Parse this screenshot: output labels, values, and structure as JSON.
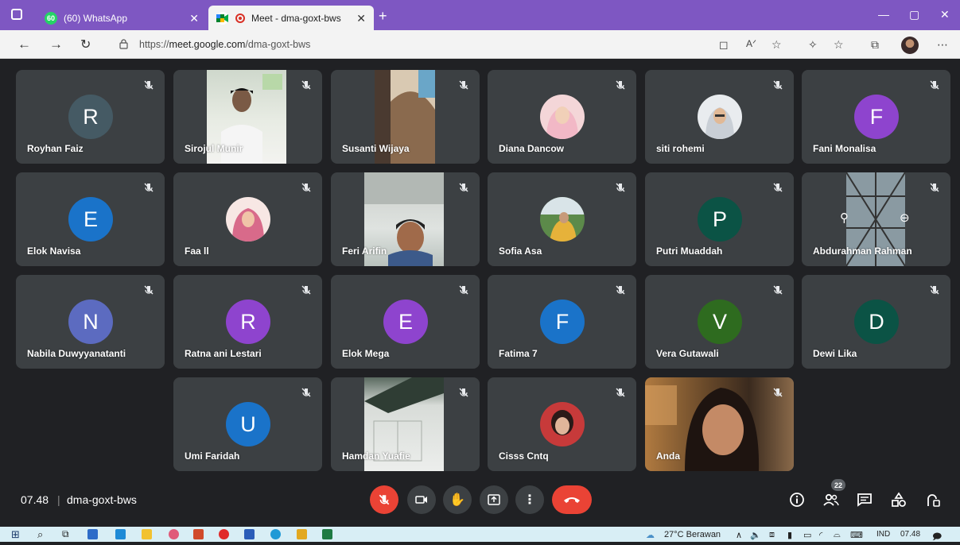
{
  "browser": {
    "tabs": [
      {
        "title": "(60) WhatsApp",
        "badge": "60"
      },
      {
        "title": "Meet - dma-goxt-bws"
      }
    ],
    "url_prefix": "https://",
    "url_host": "meet.google.com",
    "url_path": "/dma-goxt-bws"
  },
  "tiles": [
    {
      "name": "Royhan Faiz",
      "kind": "avatar",
      "initial": "R",
      "color": "#455a64"
    },
    {
      "name": "Sirojul Munir",
      "kind": "video"
    },
    {
      "name": "Susanti Wijaya",
      "kind": "video"
    },
    {
      "name": "Diana Dancow",
      "kind": "photo"
    },
    {
      "name": "siti rohemi",
      "kind": "photo"
    },
    {
      "name": "Fani Monalisa",
      "kind": "avatar",
      "initial": "F",
      "color": "#8e44ce"
    },
    {
      "name": "Elok Navisa",
      "kind": "avatar",
      "initial": "E",
      "color": "#1a73c9"
    },
    {
      "name": "Faa ll",
      "kind": "photo"
    },
    {
      "name": "Feri Arifin",
      "kind": "video"
    },
    {
      "name": "Sofia Asa",
      "kind": "photo"
    },
    {
      "name": "Putri Muaddah",
      "kind": "avatar",
      "initial": "P",
      "color": "#0b5345"
    },
    {
      "name": "Abdurahman Rahman",
      "kind": "video"
    },
    {
      "name": "Nabila Duwyyanatanti",
      "kind": "avatar",
      "initial": "N",
      "color": "#5c6bc0"
    },
    {
      "name": "Ratna ani Lestari",
      "kind": "avatar",
      "initial": "R",
      "color": "#8e44ce"
    },
    {
      "name": "Elok Mega",
      "kind": "avatar",
      "initial": "E",
      "color": "#8e44ce"
    },
    {
      "name": "Fatima 7",
      "kind": "avatar",
      "initial": "F",
      "color": "#1a73c9"
    },
    {
      "name": "Vera Gutawali",
      "kind": "avatar",
      "initial": "V",
      "color": "#2e6b1f"
    },
    {
      "name": "Dewi Lika",
      "kind": "avatar",
      "initial": "D",
      "color": "#0b5345"
    },
    {
      "name": "Umi Faridah",
      "kind": "avatar",
      "initial": "U",
      "color": "#1a73c9"
    },
    {
      "name": "Hamdan Yuafie",
      "kind": "video"
    },
    {
      "name": "Cisss Cntq",
      "kind": "photo"
    },
    {
      "name": "Anda",
      "kind": "video"
    }
  ],
  "meeting": {
    "time": "07.48",
    "separator": "|",
    "code": "dma-goxt-bws",
    "people_count": "22"
  },
  "taskbar": {
    "weather": "27°C  Berawan",
    "language": "IND",
    "clock": "07.48"
  }
}
